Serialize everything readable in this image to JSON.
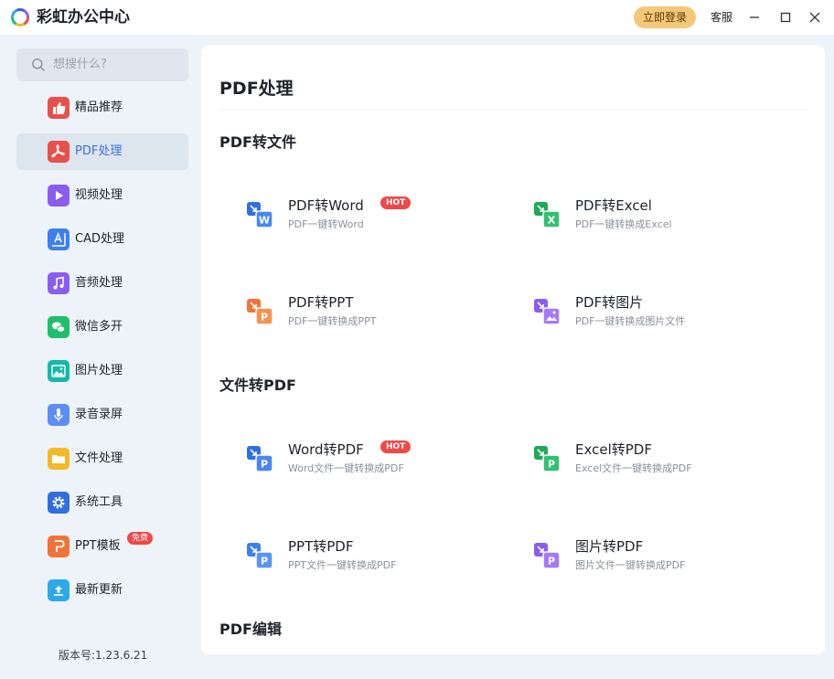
{
  "app": {
    "title": "彩虹办公中心",
    "login_label": "立即登录",
    "service_label": "客服",
    "accent": "#3f6fd8",
    "login_color": "#f5c77a",
    "hot_color": "#f04848"
  },
  "sidebar": {
    "search_placeholder": "想搜什么?",
    "items": [
      {
        "label": "精品推荐",
        "icon": "thumbs-up-icon",
        "color": "#e8504a",
        "active": false
      },
      {
        "label": "PDF处理",
        "icon": "pdf-icon",
        "color": "#e8504a",
        "active": true
      },
      {
        "label": "视频处理",
        "icon": "play-icon",
        "color": "#8b5cf0",
        "active": false
      },
      {
        "label": "CAD处理",
        "icon": "cad-icon",
        "color": "#3d7ff0",
        "active": false
      },
      {
        "label": "音频处理",
        "icon": "music-icon",
        "color": "#8b5cf0",
        "active": false
      },
      {
        "label": "微信多开",
        "icon": "wechat-icon",
        "color": "#1fbf6a",
        "active": false
      },
      {
        "label": "图片处理",
        "icon": "image-icon",
        "color": "#17b8a6",
        "active": false
      },
      {
        "label": "录音录屏",
        "icon": "microphone-icon",
        "color": "#5b8df5",
        "active": false
      },
      {
        "label": "文件处理",
        "icon": "folder-icon",
        "color": "#f5b82a",
        "active": false
      },
      {
        "label": "系统工具",
        "icon": "gear-icon",
        "color": "#2f6fe0",
        "active": false
      },
      {
        "label": "PPT模板",
        "icon": "ppt-icon",
        "color": "#f2733a",
        "active": false,
        "badge": "免费"
      },
      {
        "label": "最新更新",
        "icon": "upload-icon",
        "color": "#2ea9e8",
        "active": false
      }
    ],
    "version": "版本号:1.23.6.21"
  },
  "main": {
    "title": "PDF处理",
    "sections": [
      {
        "title": "PDF转文件",
        "tools": [
          {
            "name": "PDF转Word",
            "desc": "PDF一键转Word",
            "hot": "HOT",
            "icon": "pdf-to-word-icon",
            "color": "#2f6fe0"
          },
          {
            "name": "PDF转Excel",
            "desc": "PDF一键转换成Excel",
            "icon": "pdf-to-excel-icon",
            "color": "#1fa85a"
          },
          {
            "name": "PDF转PPT",
            "desc": "PDF一键转换成PPT",
            "icon": "pdf-to-ppt-icon",
            "color": "#f2733a"
          },
          {
            "name": "PDF转图片",
            "desc": "PDF一键转换成图片文件",
            "icon": "pdf-to-image-icon",
            "color": "#8b5cf0"
          }
        ]
      },
      {
        "title": "文件转PDF",
        "tools": [
          {
            "name": "Word转PDF",
            "desc": "Word文件一键转换成PDF",
            "hot": "HOT",
            "icon": "word-to-pdf-icon",
            "color": "#2f6fe0"
          },
          {
            "name": "Excel转PDF",
            "desc": "Excel文件一键转换成PDF",
            "icon": "excel-to-pdf-icon",
            "color": "#1fa85a"
          },
          {
            "name": "PPT转PDF",
            "desc": "PPT文件一键转换成PDF",
            "icon": "ppt-to-pdf-icon",
            "color": "#3d7ff0"
          },
          {
            "name": "图片转PDF",
            "desc": "图片文件一键转换成PDF",
            "icon": "image-to-pdf-icon",
            "color": "#8b5cf0"
          }
        ]
      },
      {
        "title": "PDF编辑",
        "tools": []
      }
    ]
  }
}
